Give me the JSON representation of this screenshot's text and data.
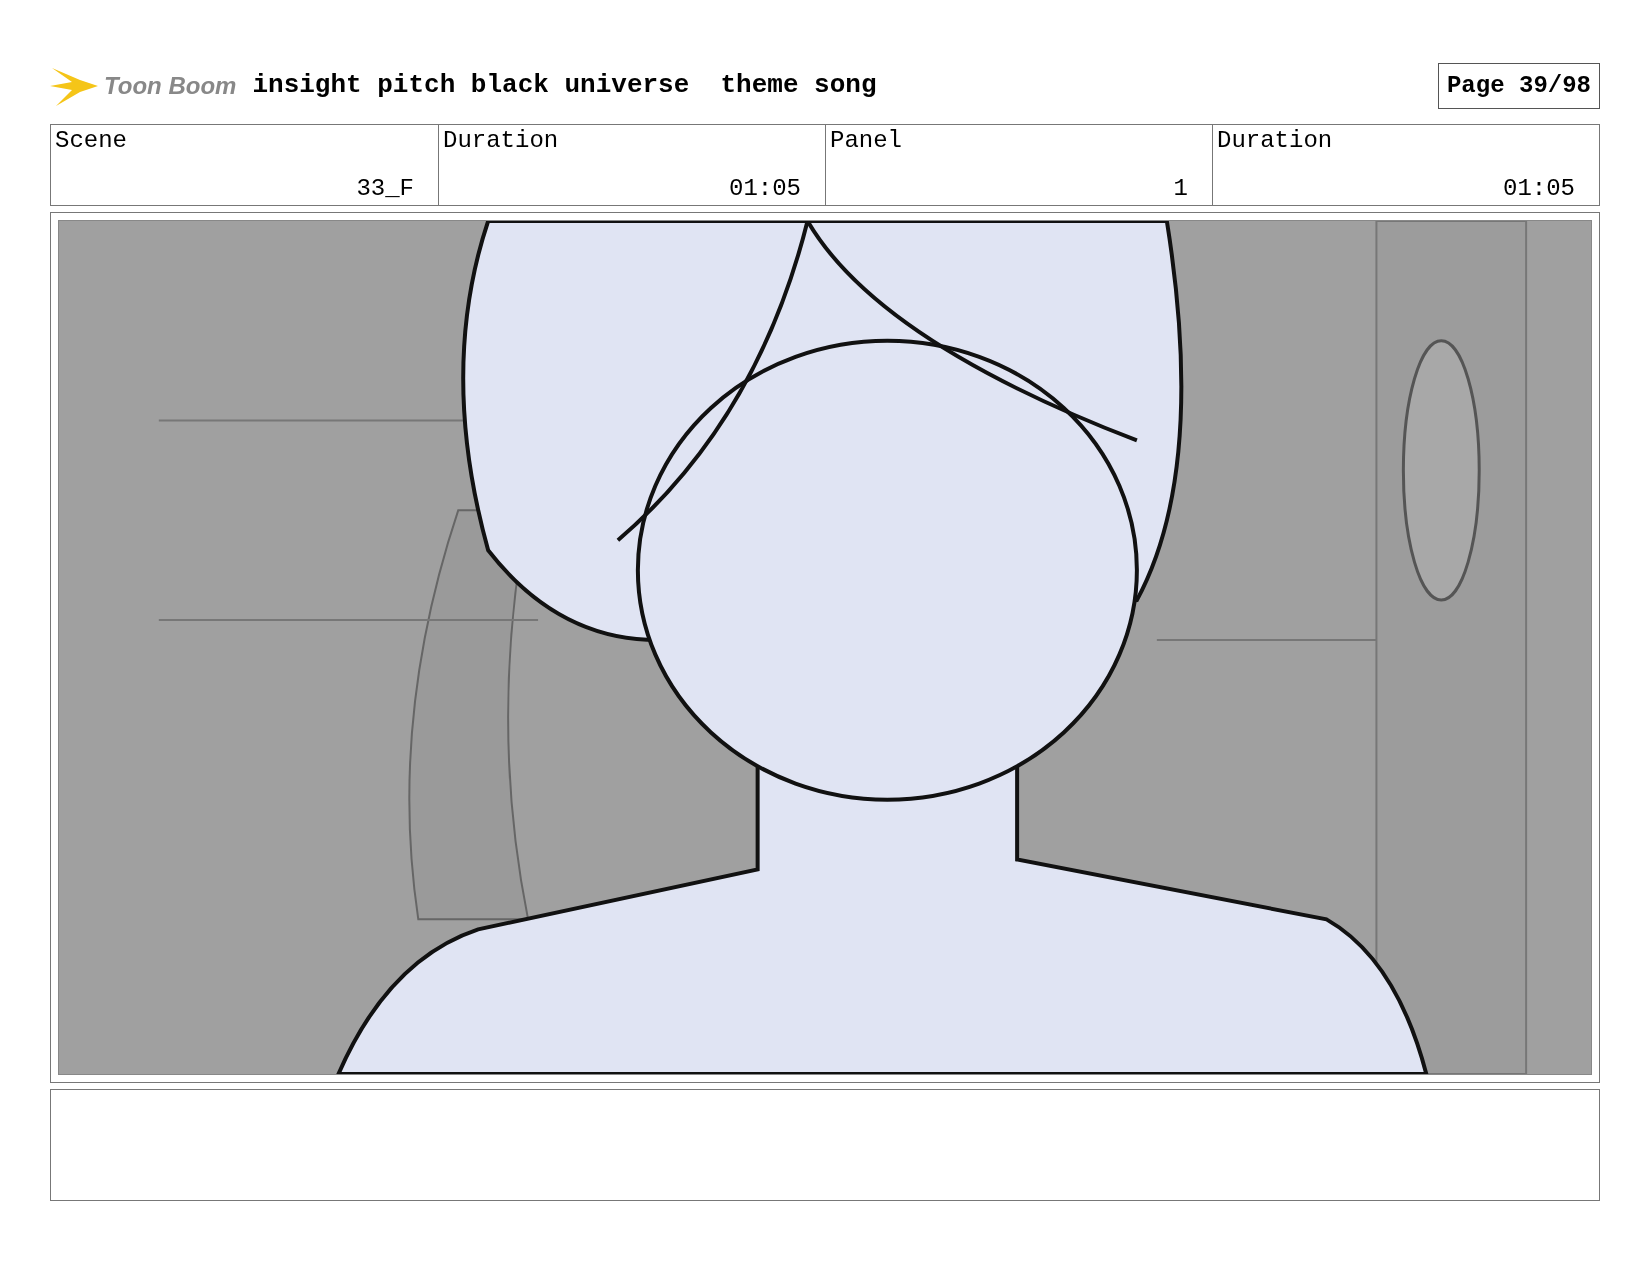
{
  "header": {
    "logo_text": "Toon Boom",
    "title": "insight pitch black universe  theme song",
    "page": "Page 39/98"
  },
  "fields": [
    {
      "label": "Scene",
      "value": "33_F"
    },
    {
      "label": "Duration",
      "value": "01:05"
    },
    {
      "label": "Panel",
      "value": "1"
    },
    {
      "label": "Duration",
      "value": "01:05"
    }
  ]
}
